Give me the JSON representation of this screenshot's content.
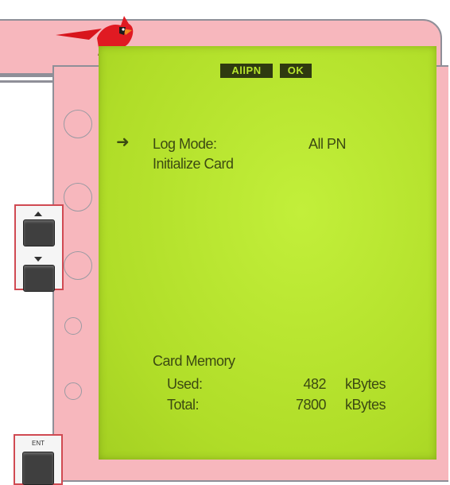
{
  "lcd": {
    "status": [
      "AllPN",
      "OK"
    ],
    "menu": {
      "cursor": "➜",
      "items": [
        {
          "label": "Log Mode:",
          "value": "All PN"
        },
        {
          "label": "Initialize Card",
          "value": ""
        }
      ]
    },
    "memory": {
      "title": "Card Memory",
      "used": {
        "label": "Used:",
        "value": "482",
        "unit": "kBytes"
      },
      "total": {
        "label": "Total:",
        "value": "7800",
        "unit": "kBytes"
      }
    }
  },
  "keys": {
    "enter_label": "ENT"
  },
  "icons": {
    "cursor": "arrow-right-icon",
    "up": "triangle-up-icon",
    "down": "triangle-down-icon",
    "logo": "cardinal-bird-icon"
  },
  "colors": {
    "lcd_background": "#b6e62c",
    "lcd_text": "#3c4a12",
    "frame": "#f7b7bd",
    "highlight_border": "#d04a52"
  }
}
